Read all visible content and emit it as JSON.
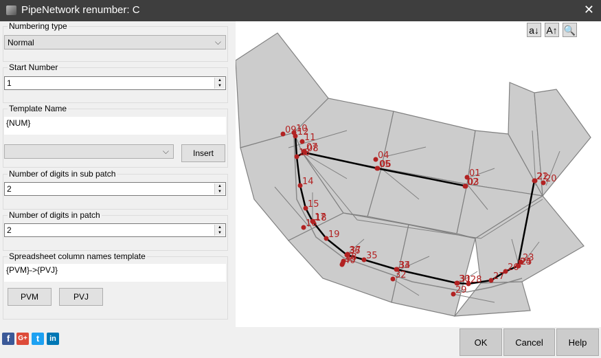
{
  "window": {
    "title": "PipeNetwork renumber: C",
    "close_icon": "close-icon"
  },
  "numbering_type": {
    "label": "Numbering type",
    "value": "Normal"
  },
  "start_number": {
    "label": "Start Number",
    "value": "1"
  },
  "template_name": {
    "label": "Template Name",
    "value": "{NUM}",
    "insert_label": "Insert",
    "dropdown_value": ""
  },
  "digits_sub_patch": {
    "label": "Number of digits in sub patch",
    "value": "2"
  },
  "digits_patch": {
    "label": "Number of digits in patch",
    "value": "2"
  },
  "spreadsheet": {
    "label": "Spreadsheet column names template",
    "value": "{PVM}->{PVJ}",
    "pvm_label": "PVM",
    "pvj_label": "PVJ"
  },
  "social": [
    "f",
    "G+",
    "t",
    "in"
  ],
  "canvas_tools": [
    "a↓",
    "A↑",
    "🔍"
  ],
  "buttons": {
    "ok": "OK",
    "cancel": "Cancel",
    "help": "Help"
  },
  "network": {
    "node_labels": [
      "01",
      "02",
      "03",
      "04",
      "05",
      "06",
      "07",
      "08",
      "09",
      "10",
      "11",
      "12",
      "13",
      "14",
      "15",
      "16",
      "17",
      "18",
      "19",
      "20",
      "21",
      "22",
      "23",
      "24",
      "25",
      "26",
      "27",
      "28",
      "29",
      "30",
      "31",
      "32",
      "33",
      "34",
      "35",
      "36",
      "37",
      "38",
      "39",
      "40"
    ],
    "node_color": "#b22222",
    "cell_color": "#cccccc"
  }
}
